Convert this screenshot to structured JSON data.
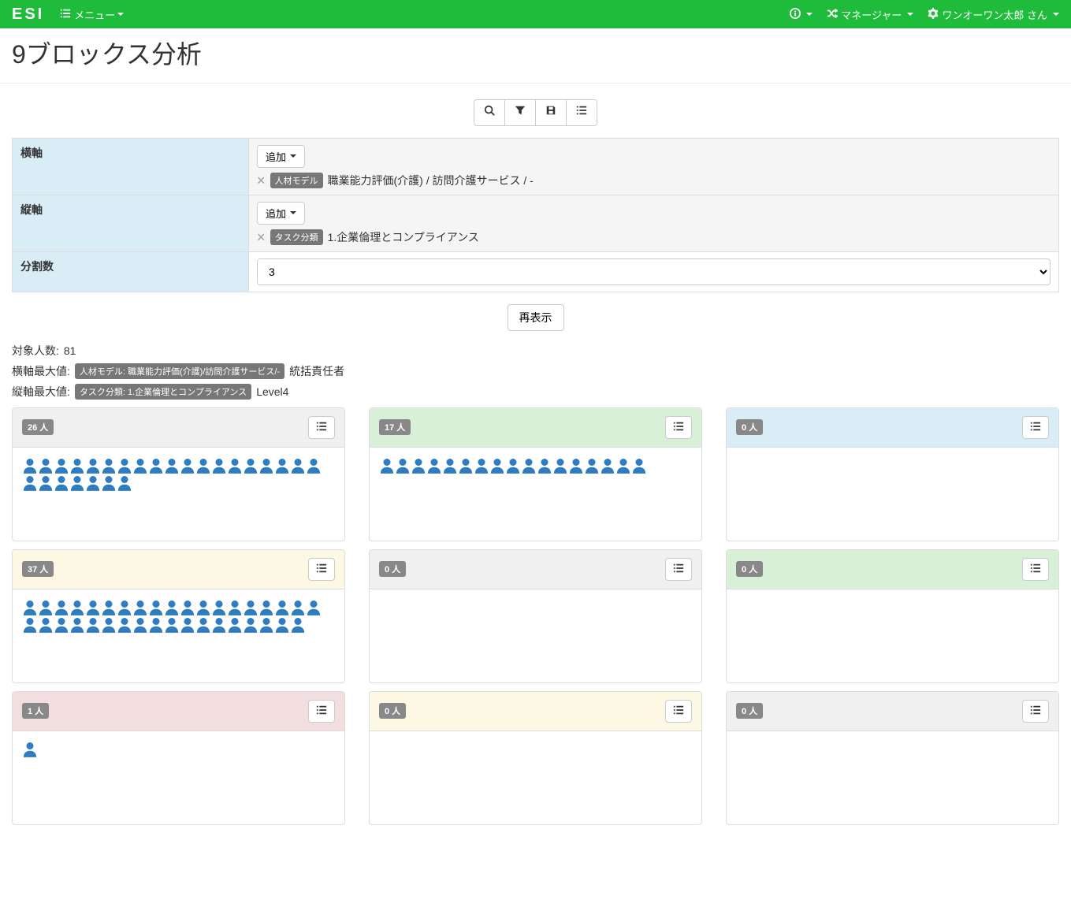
{
  "navbar": {
    "brand": "ESI",
    "menu_label": "メニュー",
    "manager_label": "マネージャー",
    "user_label": "ワンオーワン太郎 さん"
  },
  "page_title": "9ブロックス分析",
  "params": {
    "rows": [
      {
        "label": "横軸",
        "add_label": "追加",
        "tag_type": "人材モデル",
        "tag_text": "職業能力評価(介護) / 訪問介護サービス / -"
      },
      {
        "label": "縦軸",
        "add_label": "追加",
        "tag_type": "タスク分類",
        "tag_text": "1.企業倫理とコンプライアンス"
      }
    ],
    "split_label": "分割数",
    "split_value": "3"
  },
  "redisplay_label": "再表示",
  "info": {
    "target_label": "対象人数:",
    "target_value": "81",
    "hmax_label": "横軸最大値:",
    "hmax_badge": "人材モデル: 職業能力評価(介護)/訪問介護サービス/-",
    "hmax_value": "統括責任者",
    "vmax_label": "縦軸最大値:",
    "vmax_badge": "タスク分類: 1.企業倫理とコンプライアンス",
    "vmax_value": "Level4"
  },
  "grid": {
    "rows": [
      [
        {
          "count_label": "26 人",
          "count": 26,
          "header": "gray"
        },
        {
          "count_label": "17 人",
          "count": 17,
          "header": "green"
        },
        {
          "count_label": "0 人",
          "count": 0,
          "header": "blue"
        }
      ],
      [
        {
          "count_label": "37 人",
          "count": 37,
          "header": "cream"
        },
        {
          "count_label": "0 人",
          "count": 0,
          "header": "gray"
        },
        {
          "count_label": "0 人",
          "count": 0,
          "header": "green"
        }
      ],
      [
        {
          "count_label": "1 人",
          "count": 1,
          "header": "red"
        },
        {
          "count_label": "0 人",
          "count": 0,
          "header": "cream"
        },
        {
          "count_label": "0 人",
          "count": 0,
          "header": "gray"
        }
      ]
    ]
  }
}
